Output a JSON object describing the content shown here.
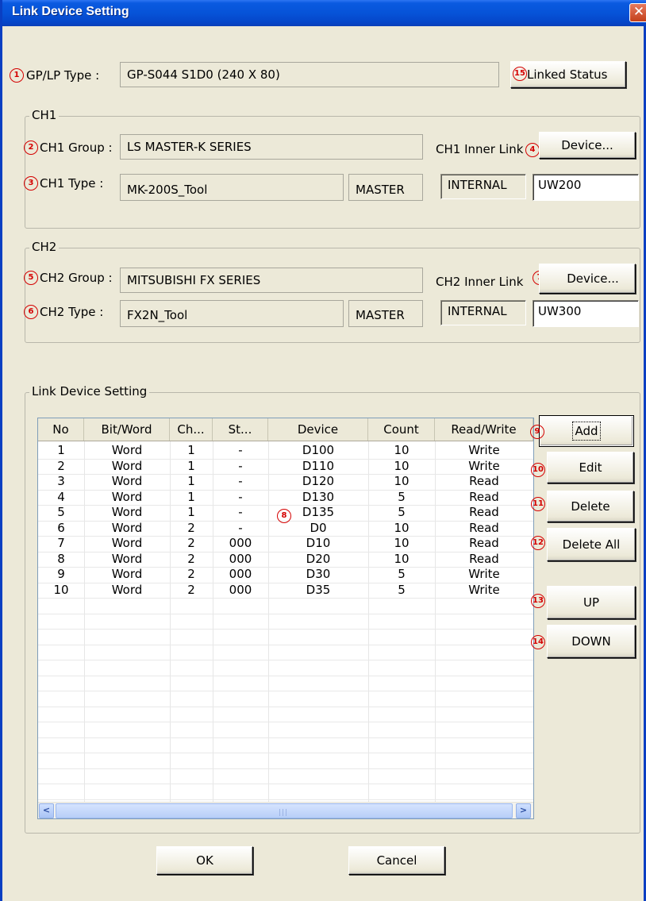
{
  "window": {
    "title": "Link Device Setting",
    "close": "✕"
  },
  "gp": {
    "num": "1",
    "label": "GP/LP Type :",
    "value": "GP-S044  S1D0  (240 X 80)",
    "linked_num": "15",
    "linked_label": "Linked Status"
  },
  "ch1": {
    "group_title": "CH1",
    "group_num": "2",
    "group_label": "CH1 Group :",
    "group_value": "LS MASTER-K SERIES",
    "inner_link_label": "CH1 Inner Link",
    "device_num": "4",
    "device_button": "Device...",
    "type_num": "3",
    "type_label": "CH1 Type :",
    "type_value": "MK-200S_Tool",
    "mode": "MASTER",
    "internal": "INTERNAL",
    "address": "UW200"
  },
  "ch2": {
    "group_title": "CH2",
    "group_num": "5",
    "group_label": "CH2 Group :",
    "group_value": "MITSUBISHI FX SERIES",
    "inner_link_label": "CH2 Inner Link",
    "device_num": "7",
    "device_button": "Device...",
    "type_num": "6",
    "type_label": "CH2 Type :",
    "type_value": "FX2N_Tool",
    "mode": "MASTER",
    "internal": "INTERNAL",
    "address": "UW300"
  },
  "link": {
    "group_title": "Link Device Setting",
    "table_num": "8",
    "columns": [
      "No",
      "Bit/Word",
      "Ch...",
      "St...",
      "Device",
      "Count",
      "Read/Write"
    ],
    "rows": [
      [
        "1",
        "Word",
        "1",
        "-",
        "D100",
        "10",
        "Write"
      ],
      [
        "2",
        "Word",
        "1",
        "-",
        "D110",
        "10",
        "Write"
      ],
      [
        "3",
        "Word",
        "1",
        "-",
        "D120",
        "10",
        "Read"
      ],
      [
        "4",
        "Word",
        "1",
        "-",
        "D130",
        "5",
        "Read"
      ],
      [
        "5",
        "Word",
        "1",
        "-",
        "D135",
        "5",
        "Read"
      ],
      [
        "6",
        "Word",
        "2",
        "-",
        "D0",
        "10",
        "Read"
      ],
      [
        "7",
        "Word",
        "2",
        "000",
        "D10",
        "10",
        "Read"
      ],
      [
        "8",
        "Word",
        "2",
        "000",
        "D20",
        "10",
        "Read"
      ],
      [
        "9",
        "Word",
        "2",
        "000",
        "D30",
        "5",
        "Write"
      ],
      [
        "10",
        "Word",
        "2",
        "000",
        "D35",
        "5",
        "Write"
      ]
    ],
    "buttons": {
      "add": {
        "num": "9",
        "label": "Add"
      },
      "edit": {
        "num": "10",
        "label": "Edit"
      },
      "delete": {
        "num": "11",
        "label": "Delete"
      },
      "delete_all": {
        "num": "12",
        "label": "Delete All"
      },
      "up": {
        "num": "13",
        "label": "UP"
      },
      "down": {
        "num": "14",
        "label": "DOWN"
      }
    },
    "scroll_left": "<",
    "scroll_right": ">",
    "scroll_grip": "|||"
  },
  "footer": {
    "ok": "OK",
    "cancel": "Cancel"
  },
  "colors": {
    "title_bar": "#0653d8",
    "dialog_bg": "#ece9d8",
    "marker": "#d40000"
  }
}
